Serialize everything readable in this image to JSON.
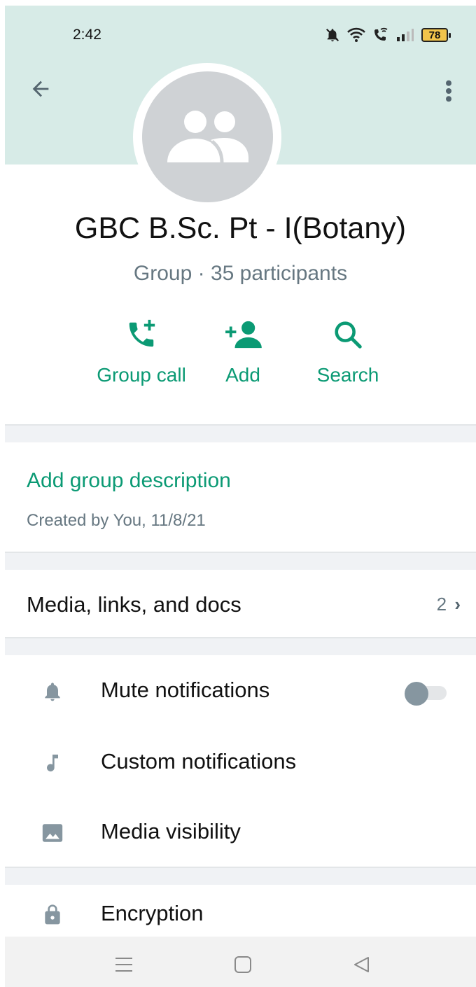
{
  "status_bar": {
    "time": "2:42",
    "battery": "78",
    "icons": [
      "mute-bell-icon",
      "wifi-icon",
      "wifi-call-icon",
      "signal-icon",
      "battery-icon"
    ]
  },
  "header": {
    "back_icon": "arrow-left-icon",
    "menu_icon": "more-vert-icon",
    "avatar_icon": "group-icon"
  },
  "group": {
    "name": "GBC B.Sc. Pt - I(Botany)",
    "subtitle": "Group · 35 participants"
  },
  "actions": [
    {
      "label": "Group call",
      "icon": "add-call-icon"
    },
    {
      "label": "Add",
      "icon": "add-person-icon"
    },
    {
      "label": "Search",
      "icon": "search-icon"
    }
  ],
  "description": {
    "add_label": "Add group description",
    "created": "Created by You, 11/8/21"
  },
  "media": {
    "label": "Media, links, and docs",
    "count": "2",
    "chevron": "›"
  },
  "settings": [
    {
      "label": "Mute notifications",
      "icon": "bell-icon",
      "toggle": false
    },
    {
      "label": "Custom notifications",
      "icon": "music-note-icon"
    },
    {
      "label": "Media visibility",
      "icon": "image-icon"
    },
    {
      "label": "Encryption",
      "icon": "lock-icon"
    }
  ],
  "colors": {
    "accent": "#0b9a74",
    "header_bg": "#d7ebe7",
    "secondary_text": "#667781",
    "icon_grey": "#8696a0"
  },
  "nav": [
    "menu-icon",
    "home-square-icon",
    "back-triangle-icon"
  ]
}
